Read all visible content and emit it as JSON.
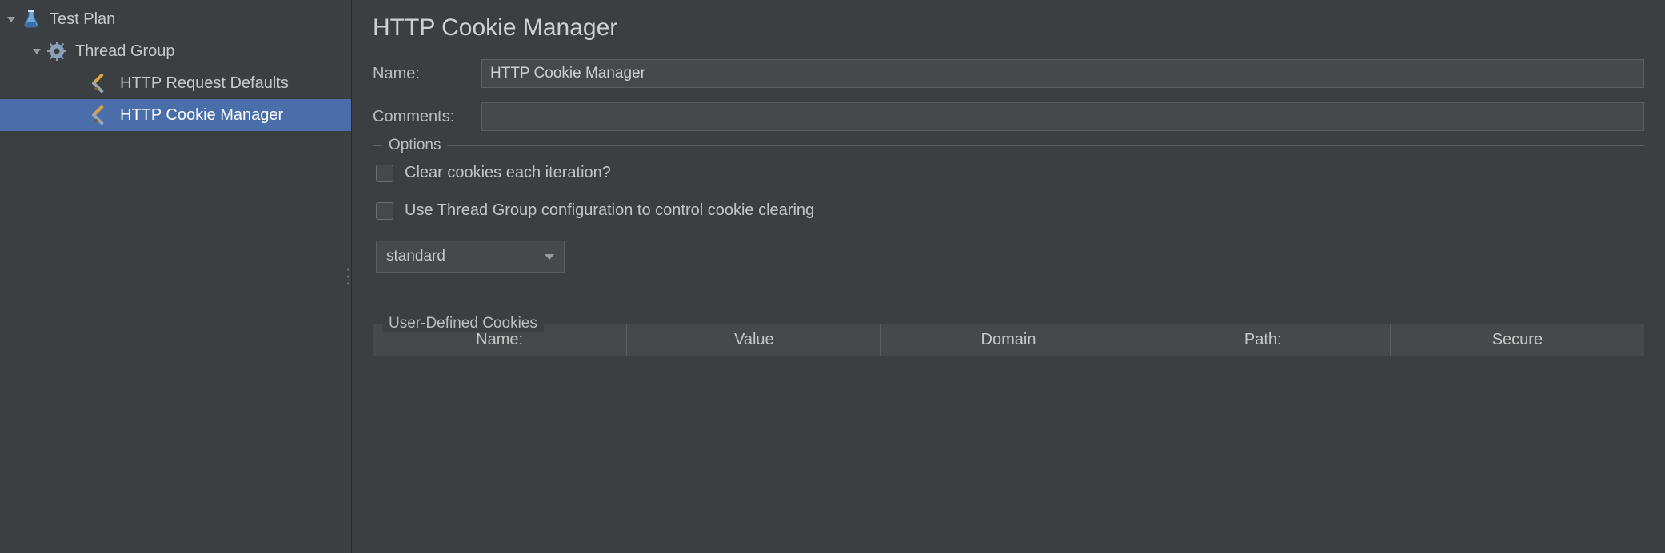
{
  "tree": {
    "testPlan": "Test Plan",
    "threadGroup": "Thread Group",
    "httpRequestDefaults": "HTTP Request Defaults",
    "httpCookieManager": "HTTP Cookie Manager"
  },
  "main": {
    "title": "HTTP Cookie Manager",
    "nameLabel": "Name:",
    "nameValue": "HTTP Cookie Manager",
    "commentsLabel": "Comments:",
    "commentsValue": ""
  },
  "options": {
    "legend": "Options",
    "clearEachIteration": "Clear cookies each iteration?",
    "useThreadGroupConfig": "Use Thread Group configuration to control cookie clearing",
    "policySelected": "standard"
  },
  "cookies": {
    "legend": "User-Defined Cookies",
    "columns": {
      "name": "Name:",
      "value": "Value",
      "domain": "Domain",
      "path": "Path:",
      "secure": "Secure"
    }
  }
}
